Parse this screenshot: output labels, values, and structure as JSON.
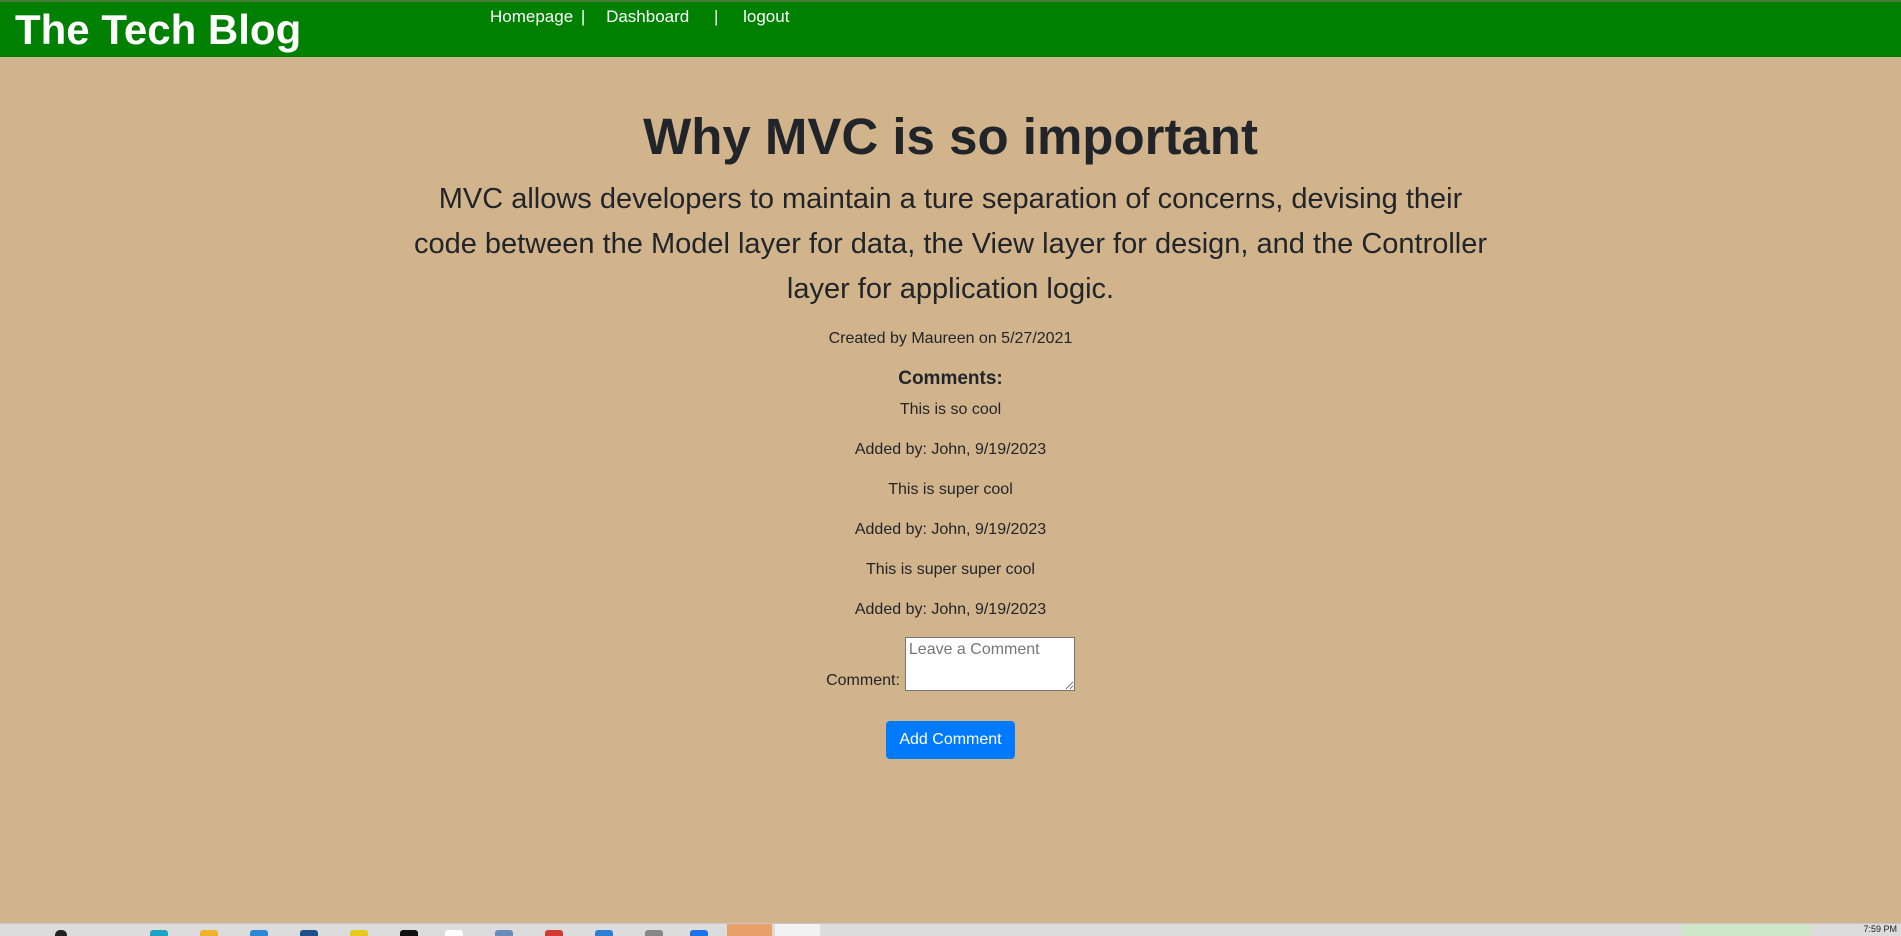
{
  "header": {
    "brand": "The Tech Blog",
    "nav": [
      {
        "label": "Homepage"
      },
      {
        "label": "Dashboard"
      },
      {
        "label": "logout"
      }
    ],
    "separator": "|",
    "background_color": "#008000"
  },
  "post": {
    "title": "Why MVC is so important",
    "body": "MVC allows developers to maintain a ture separation of concerns, devising their code between the Model layer for data, the View layer for design, and the Controller layer for application logic.",
    "meta": "Created by Maureen on 5/27/2021"
  },
  "comments": {
    "heading": "Comments:",
    "items": [
      {
        "text": "This is so cool",
        "meta": "Added by: John, 9/19/2023"
      },
      {
        "text": "This is super cool",
        "meta": "Added by: John, 9/19/2023"
      },
      {
        "text": "This is super super cool",
        "meta": "Added by: John, 9/19/2023"
      }
    ]
  },
  "form": {
    "label": "Comment:",
    "placeholder": "Leave a Comment",
    "button": "Add Comment",
    "button_color": "#007bff"
  },
  "page": {
    "background_color": "#d2b48c"
  },
  "taskbar": {
    "clock": "7:59 PM",
    "icons": [
      "search-icon",
      "edge-icon",
      "file-explorer-icon",
      "store-icon",
      "app-icon",
      "chrome-icon"
    ]
  }
}
